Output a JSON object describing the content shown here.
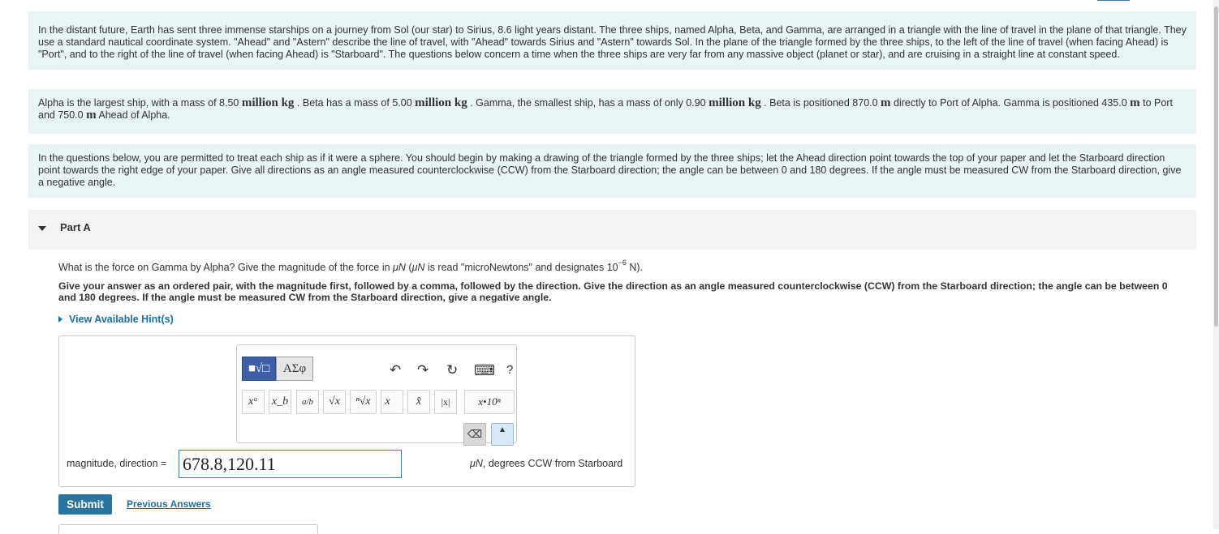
{
  "intro": {
    "paragraph1": "In the distant future, Earth has sent three immense starships on a journey from Sol (our star) to Sirius, 8.6 light years distant. The three ships, named Alpha, Beta, and Gamma, are arranged in a triangle with the line of travel in the plane of that triangle. They use a standard nautical coordinate system. \"Ahead\" and \"Astern\" describe the line of travel, with \"Ahead\" towards Sirius and \"Astern\" towards Sol. In the plane of the triangle formed by the three ships, to the left of the line of travel (when facing Ahead) is \"Port\", and to the right of the line of travel (when facing Ahead) is \"Starboard\". The questions below concern a time when the three ships are very far from any massive object (planet or star), and are cruising in a straight line at constant speed.",
    "p2": {
      "t1": "Alpha is the largest ship, with a mass of 8.50 ",
      "u1": "million kg",
      "t2": " . Beta has a mass of 5.00 ",
      "u2": "million kg",
      "t3": " . Gamma, the smallest ship, has a mass of only 0.90 ",
      "u3": "million kg",
      "t4": " . Beta is positioned 870.0 ",
      "u4": "m",
      "t5": " directly to Port of Alpha. Gamma is positioned 435.0 ",
      "u5": "m",
      "t6": " to Port and 750.0 ",
      "u6": "m",
      "t7": " Ahead of Alpha."
    },
    "paragraph3": "In the questions below, you are permitted to treat each ship as if it were a sphere. You should begin by making a drawing of the triangle formed by the three ships; let the Ahead direction point towards the top of your paper and let the Starboard direction point towards the right edge of your paper. Give all directions as an angle measured counterclockwise (CCW) from the Starboard direction; the angle can be between 0 and 180 degrees. If the angle must be measured CW from the Starboard direction, give a negative angle."
  },
  "part": {
    "title": "Part A",
    "question_a": "What is the force on Gamma by Alpha? Give the magnitude of the force in ",
    "question_mu": "μN",
    "question_b": " (",
    "question_mu2": "μN",
    "question_c": " is read \"microNewtons\" and designates 10",
    "question_exp": "−6",
    "question_d": " N).",
    "instruction": "Give your answer as an ordered pair, with the magnitude first, followed by a comma, followed by the direction. Give the direction as an angle measured counterclockwise (CCW) from the Starboard direction; the angle can be between 0 and 180 degrees. If the angle must be measured CW from the Starboard direction, give a negative angle.",
    "hint_label": "View Available Hint(s)"
  },
  "toolbar": {
    "template_btn": "■√□",
    "greek_btn": "ΑΣφ",
    "undo": "↶",
    "redo": "↷",
    "reset": "↻",
    "keyboard": "⌨",
    "help": "?",
    "buttons": [
      "xᵃ",
      "x_b",
      "a/b",
      "√x",
      "ⁿ√x",
      "x⃗",
      "x̂",
      "|x|",
      "x•10ⁿ"
    ],
    "backspace": "⌫",
    "keyboard_toggle": "▲"
  },
  "answer": {
    "label": "magnitude, direction =",
    "value": "678.8,120.11",
    "unit_mu": "μN",
    "unit_rest": ", degrees CCW from Starboard"
  },
  "actions": {
    "submit": "Submit",
    "previous": "Previous Answers"
  }
}
